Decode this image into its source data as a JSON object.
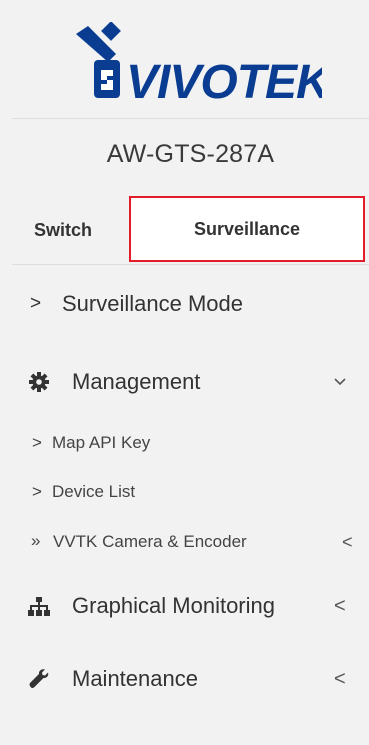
{
  "brand": {
    "logo_text": "VIVOTEK",
    "color": "#0a3d91"
  },
  "device": {
    "name": "AW-GTS-287A"
  },
  "tabs": [
    {
      "label": "Switch",
      "active": false
    },
    {
      "label": "Surveillance",
      "active": true,
      "highlight_color": "#e21c2a"
    }
  ],
  "menu": {
    "surveillance_mode": {
      "label": "Surveillance Mode",
      "prefix": ">"
    },
    "management": {
      "label": "Management",
      "icon": "gear-icon",
      "chevron": "v",
      "children": [
        {
          "label": "Map API Key",
          "prefix": ">"
        },
        {
          "label": "Device List",
          "prefix": ">"
        },
        {
          "label": "VVTK Camera & Encoder",
          "prefix": "»",
          "chevron": "<"
        }
      ]
    },
    "graphical_monitoring": {
      "label": "Graphical Monitoring",
      "icon": "sitemap-icon",
      "chevron": "<"
    },
    "maintenance": {
      "label": "Maintenance",
      "icon": "wrench-icon",
      "chevron": "<"
    }
  }
}
